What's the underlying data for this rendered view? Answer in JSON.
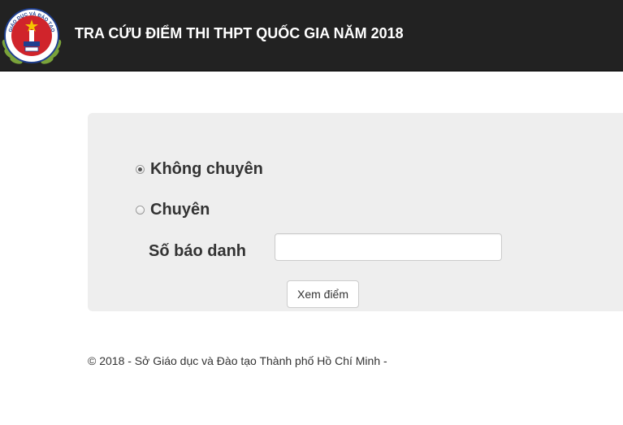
{
  "header": {
    "title": "TRA CỨU ĐIỂM THI THPT QUỐC GIA NĂM 2018",
    "logo_icon": "department-of-education-emblem",
    "logo_text": "GIÁO DỤC VÀ ĐÀO TẠO"
  },
  "form": {
    "options": [
      {
        "label": "Không chuyên",
        "checked": true
      },
      {
        "label": "Chuyên",
        "checked": false
      }
    ],
    "candidate_number_label": "Số báo danh",
    "candidate_number_value": "",
    "submit_label": "Xem điểm"
  },
  "footer": {
    "text": "© 2018 - Sở Giáo dục và Đào tạo Thành phố Hồ Chí Minh -"
  },
  "colors": {
    "navbar": "#222222",
    "panel": "#eeeeee",
    "emblem_red": "#d0242b",
    "emblem_blue": "#1f3f8f",
    "emblem_gold": "#f5c400"
  }
}
